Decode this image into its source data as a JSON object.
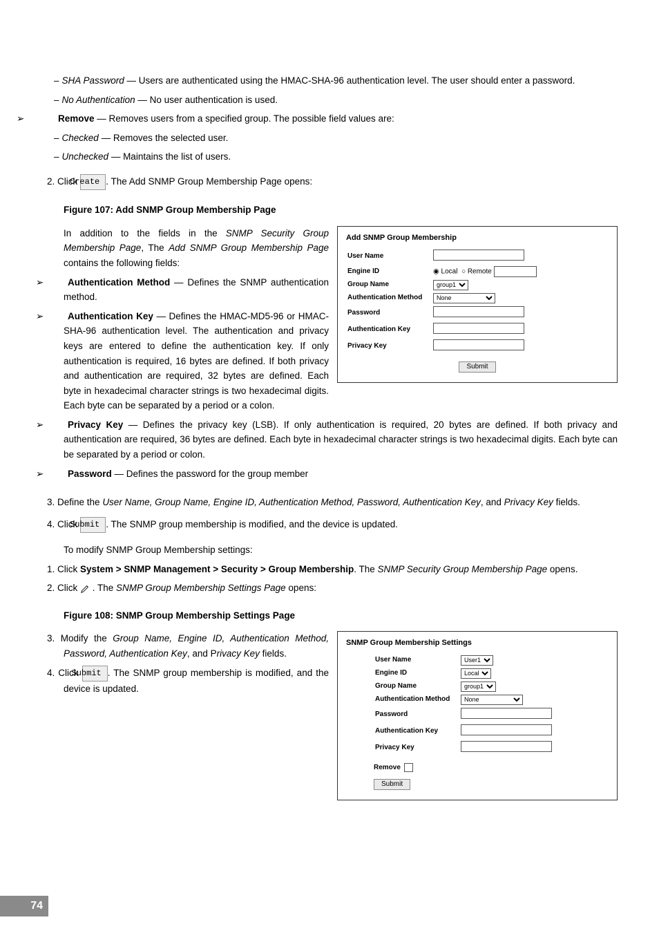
{
  "topSub": {
    "sha": {
      "label": "SHA Password",
      "text": " — Users are authenticated using the HMAC-SHA-96 authentication level. The user should enter a password."
    },
    "noauth": {
      "label": "No Authentication",
      "text": " — No user authentication is used."
    }
  },
  "remove": {
    "label": "Remove",
    "text": " — Removes users from a specified group. The possible field values are:",
    "checked": {
      "label": "Checked",
      "text": " — Removes the selected user."
    },
    "unchecked": {
      "label": "Unchecked",
      "text": " — Maintains the list of users."
    }
  },
  "step2": {
    "pre": "2.   Click ",
    "btn": "Create",
    "post": ". The Add SNMP Group Membership Page opens:"
  },
  "fig107": "Figure 107: Add SNMP Group Membership Page",
  "addBoxTitle": "Add SNMP Group Membership",
  "addBox": {
    "userName": "User Name",
    "engineId": "Engine ID",
    "engineLocal": "Local",
    "engineRemote": "Remote",
    "groupName": "Group Name",
    "groupSel": "group1",
    "authMethod": "Authentication Method",
    "authSel": "None",
    "password": "Password",
    "authKey": "Authentication Key",
    "privKey": "Privacy Key",
    "submit": "Submit"
  },
  "intro107a": "In addition to the fields in the ",
  "intro107b": "SNMP Security Group Membership Page",
  "intro107c": ", The ",
  "intro107d": "Add SNMP Group Membership Page",
  "intro107e": " contains the following fields:",
  "bulAuthM": {
    "label": "Authentication Method",
    "text": " — Defines the SNMP authentication method."
  },
  "bulAuthK": {
    "label": "Authentication Key",
    "text": " — Defines the HMAC-MD5-96 or HMAC-SHA-96 authentication level. The authentication and privacy keys are entered to define the authentication key. If only authentication is required, 16 bytes are defined. If both privacy and authentication are required, 32 bytes are defined. Each byte in hexadecimal character strings is two hexadecimal digits. Each byte can be separated by a period or a colon."
  },
  "bulPrivK": {
    "label": "Privacy Key",
    "text": " — Defines the privacy key (LSB). If only authentication is required, 20 bytes are defined. If both privacy and authentication are required, 36 bytes are defined. Each byte in hexadecimal character strings is two hexadecimal digits. Each byte can be separated by a period or colon."
  },
  "bulPass": {
    "label": "Password",
    "text": " — Defines the password for the group member"
  },
  "step3": {
    "pre": "3.   Define the ",
    "em": "User Name, Group Name, Engine ID, Authentication Method, Password, Authentication Key",
    "mid": ", and ",
    "em2": "Privacy Key",
    "post": " fields."
  },
  "step4": {
    "pre": "4.   Click ",
    "btn": "Submit",
    "post": ". The SNMP group membership is modified, and the device is updated."
  },
  "modHeader": "To modify SNMP Group Membership settings:",
  "mod1": {
    "pre": "1.   Click ",
    "bold": "System > SNMP Management > Security > Group Membership",
    "mid": ". The ",
    "em": "SNMP Security Group Membership Page",
    "post": " opens."
  },
  "mod2": {
    "pre": "2.   Click ",
    "mid": " . The ",
    "em": "SNMP Group Membership Settings Page",
    "post": " opens:"
  },
  "fig108": "Figure 108: SNMP Group Membership Settings Page",
  "set3": {
    "pre": "3.   Modify the ",
    "em": "Group Name, Engine ID, Authentication Method, Password, Authentication Key",
    "mid": ", and P",
    "em2": "rivacy Key",
    "post": " fields."
  },
  "set4": {
    "pre": "4.   Click ",
    "btn": "Submit",
    "post": ". The SNMP group membership is modified, and the device is updated."
  },
  "setBoxTitle": "SNMP Group Membership Settings",
  "setBox": {
    "userName": "User Name",
    "userSel": "User1",
    "engineId": "Engine ID",
    "engineSel": "Local",
    "groupName": "Group Name",
    "groupSel": "group1",
    "authMethod": "Authentication Method",
    "authSel": "None",
    "password": "Password",
    "authKey": "Authentication Key",
    "privKey": "Privacy Key",
    "remove": "Remove",
    "submit": "Submit"
  },
  "pageNum": "74"
}
